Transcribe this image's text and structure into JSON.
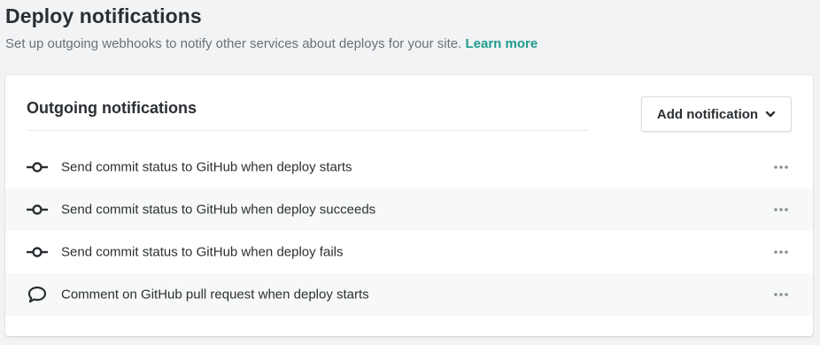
{
  "header": {
    "title": "Deploy notifications",
    "subtitle": "Set up outgoing webhooks to notify other services about deploys for your site.",
    "learn_more": "Learn more"
  },
  "card": {
    "title": "Outgoing notifications",
    "add_button_label": "Add notification",
    "rows": [
      {
        "icon": "commit-icon",
        "label": "Send commit status to GitHub when deploy starts"
      },
      {
        "icon": "commit-icon",
        "label": "Send commit status to GitHub when deploy succeeds"
      },
      {
        "icon": "commit-icon",
        "label": "Send commit status to GitHub when deploy fails"
      },
      {
        "icon": "comment-icon",
        "label": "Comment on GitHub pull request when deploy starts"
      }
    ]
  },
  "colors": {
    "accent": "#1e9b8c",
    "text": "#2b2f33",
    "muted": "#6a7075",
    "background": "#f2f3f4"
  }
}
